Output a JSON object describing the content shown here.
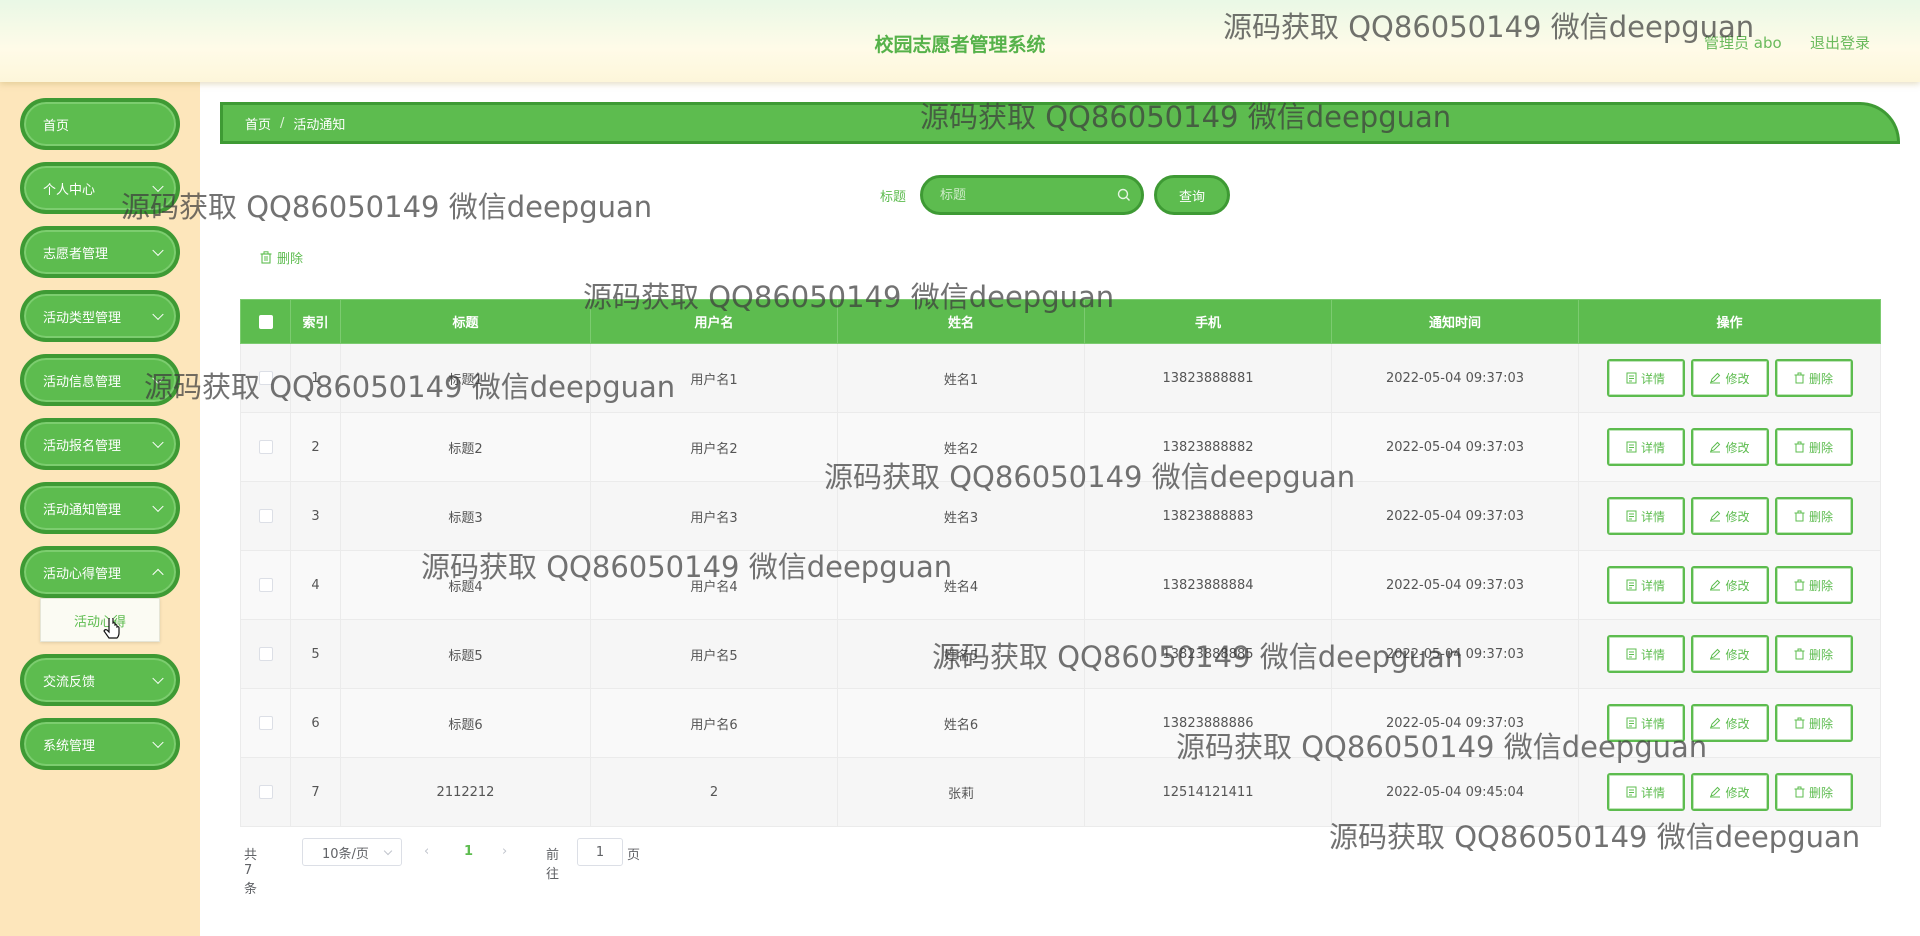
{
  "header": {
    "title": "校园志愿者管理系统",
    "admin_label": "管理员 abo",
    "logout_label": "退出登录"
  },
  "sidebar": {
    "items": [
      {
        "label": "首页",
        "has_submenu": false
      },
      {
        "label": "个人中心",
        "has_submenu": true
      },
      {
        "label": "志愿者管理",
        "has_submenu": true
      },
      {
        "label": "活动类型管理",
        "has_submenu": true
      },
      {
        "label": "活动信息管理",
        "has_submenu": true
      },
      {
        "label": "活动报名管理",
        "has_submenu": true
      },
      {
        "label": "活动通知管理",
        "has_submenu": true
      },
      {
        "label": "活动心得管理",
        "has_submenu": true
      },
      {
        "label": "交流反馈",
        "has_submenu": true
      },
      {
        "label": "系统管理",
        "has_submenu": true
      }
    ],
    "submenu_item": "活动心得"
  },
  "breadcrumb": {
    "home": "首页",
    "separator": "/",
    "current": "活动通知"
  },
  "search": {
    "label": "标题",
    "placeholder": "标题",
    "value": "",
    "query_button": "查询"
  },
  "toolbar": {
    "delete_label": "删除"
  },
  "table": {
    "columns": [
      "索引",
      "标题",
      "用户名",
      "姓名",
      "手机",
      "通知时间",
      "操作"
    ],
    "rows": [
      {
        "index": "1",
        "title": "标题1",
        "username": "用户名1",
        "name": "姓名1",
        "phone": "13823888881",
        "time": "2022-05-04 09:37:03"
      },
      {
        "index": "2",
        "title": "标题2",
        "username": "用户名2",
        "name": "姓名2",
        "phone": "13823888882",
        "time": "2022-05-04 09:37:03"
      },
      {
        "index": "3",
        "title": "标题3",
        "username": "用户名3",
        "name": "姓名3",
        "phone": "13823888883",
        "time": "2022-05-04 09:37:03"
      },
      {
        "index": "4",
        "title": "标题4",
        "username": "用户名4",
        "name": "姓名4",
        "phone": "13823888884",
        "time": "2022-05-04 09:37:03"
      },
      {
        "index": "5",
        "title": "标题5",
        "username": "用户名5",
        "name": "姓名5",
        "phone": "13823888885",
        "time": "2022-05-04 09:37:03"
      },
      {
        "index": "6",
        "title": "标题6",
        "username": "用户名6",
        "name": "姓名6",
        "phone": "13823888886",
        "time": "2022-05-04 09:37:03"
      },
      {
        "index": "7",
        "title": "2112212",
        "username": "2",
        "name": "张莉",
        "phone": "12514121411",
        "time": "2022-05-04 09:45:04"
      }
    ],
    "actions": {
      "detail": "详情",
      "edit": "修改",
      "delete": "删除"
    }
  },
  "pagination": {
    "total": "共 7 条",
    "page_size": "10条/页",
    "current_page": "1",
    "goto_label": "前往",
    "goto_value": "1",
    "page_suffix": "页"
  },
  "watermark": "源码获取 QQ86050149 微信deepguan",
  "colors": {
    "primary": "#5dbc4f",
    "primary_border": "#3e9a34",
    "sidebar_bg": "#fde6bb"
  }
}
